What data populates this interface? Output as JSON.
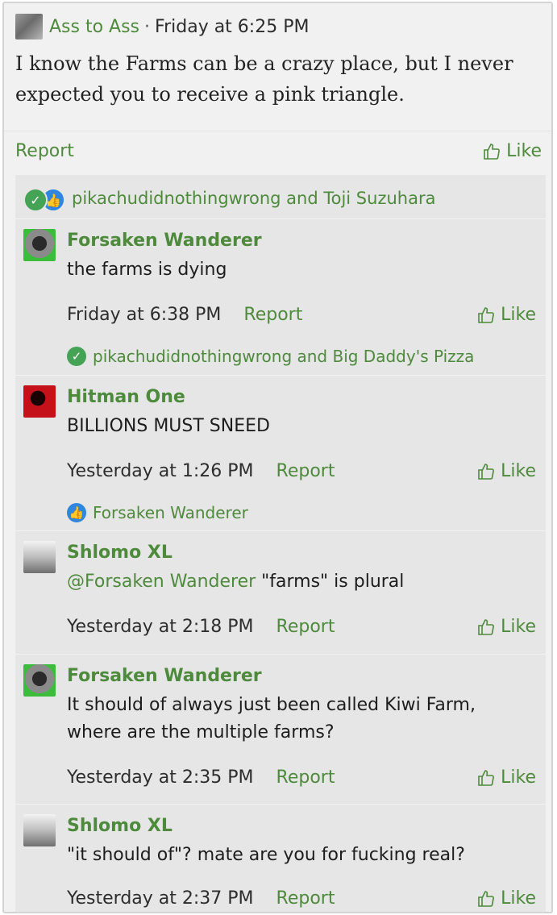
{
  "post": {
    "username": "Ass to Ass",
    "separator": "·",
    "time": "Friday at 6:25 PM",
    "body": "I know the Farms can be a crazy place, but I never expected you to receive a pink triangle.",
    "report_label": "Report",
    "like_label": "Like",
    "reactors": "pikachudidnothingwrong and Toji Suzuhara"
  },
  "replies": [
    {
      "name": "Forsaken Wanderer",
      "text": "the farms is dying",
      "time": "Friday at 6:38 PM",
      "report_label": "Report",
      "like_label": "Like",
      "reactors": "pikachudidnothingwrong and Big Daddy's Pizza"
    },
    {
      "name": "Hitman One",
      "text": "BILLIONS MUST SNEED",
      "time": "Yesterday at 1:26 PM",
      "report_label": "Report",
      "like_label": "Like",
      "reactors": "Forsaken Wanderer"
    },
    {
      "name": "Shlomo XL",
      "mention": "@Forsaken Wanderer",
      "text": " \"farms\" is plural",
      "time": "Yesterday at 2:18 PM",
      "report_label": "Report",
      "like_label": "Like"
    },
    {
      "name": "Forsaken Wanderer",
      "text": "It should of always just been called Kiwi Farm, where are the multiple farms?",
      "time": "Yesterday at 2:35 PM",
      "report_label": "Report",
      "like_label": "Like"
    },
    {
      "name": "Shlomo XL",
      "text": "\"it should of\"? mate are you for fucking real?",
      "time": "Yesterday at 2:37 PM",
      "report_label": "Report",
      "like_label": "Like"
    }
  ],
  "icons": {
    "check": "check-reaction-icon",
    "thumb": "thumbs-up-reaction-icon",
    "like": "thumbs-up-outline-icon"
  },
  "colors": {
    "link_green": "#4e8a3c",
    "check_green": "#45a356",
    "thumb_blue": "#2f86df",
    "background": "#f1f1f1",
    "comment_bg": "#e6e6e6"
  }
}
